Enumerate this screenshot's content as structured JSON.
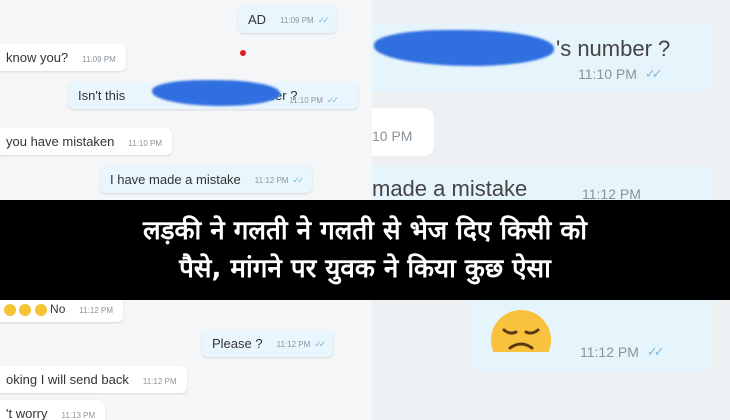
{
  "left_chat": {
    "messages": [
      {
        "text": "AD",
        "time": "11:09 PM"
      },
      {
        "text": "know you?",
        "time": "11:09 PM"
      },
      {
        "text_before": "Isn't this",
        "text_after": "number ?",
        "time": "11:10 PM"
      },
      {
        "text": "you have mistaken",
        "time": "11:10 PM"
      },
      {
        "text": "I have made a mistake",
        "time": "11:12 PM"
      },
      {
        "text": "No",
        "time": "11:12 PM"
      },
      {
        "text": "Please ?",
        "time": "11:12 PM"
      },
      {
        "text": "oking I will send back",
        "time": "11:12 PM"
      },
      {
        "text": "'t worry",
        "time": "11:13 PM"
      }
    ]
  },
  "zoom_chat": {
    "msg1_text": "'s number ?",
    "msg1_time": "11:10 PM",
    "msg2_time": "10 PM",
    "msg3_text": "made a mistake",
    "msg3_time": "11:12 PM",
    "msg4_time": "11:12 PM"
  },
  "headline": {
    "line1": "लड़की ने गलती ने गलती से भेज दिए किसी को",
    "line2": "पैसे, मांगने पर युवक ने किया कुछ ऐसा"
  },
  "colors": {
    "banner_bg": "#000000",
    "outgoing_bubble": "#eaf6fd",
    "redaction": "#2f6fe0",
    "tick": "#7eb6d8"
  }
}
